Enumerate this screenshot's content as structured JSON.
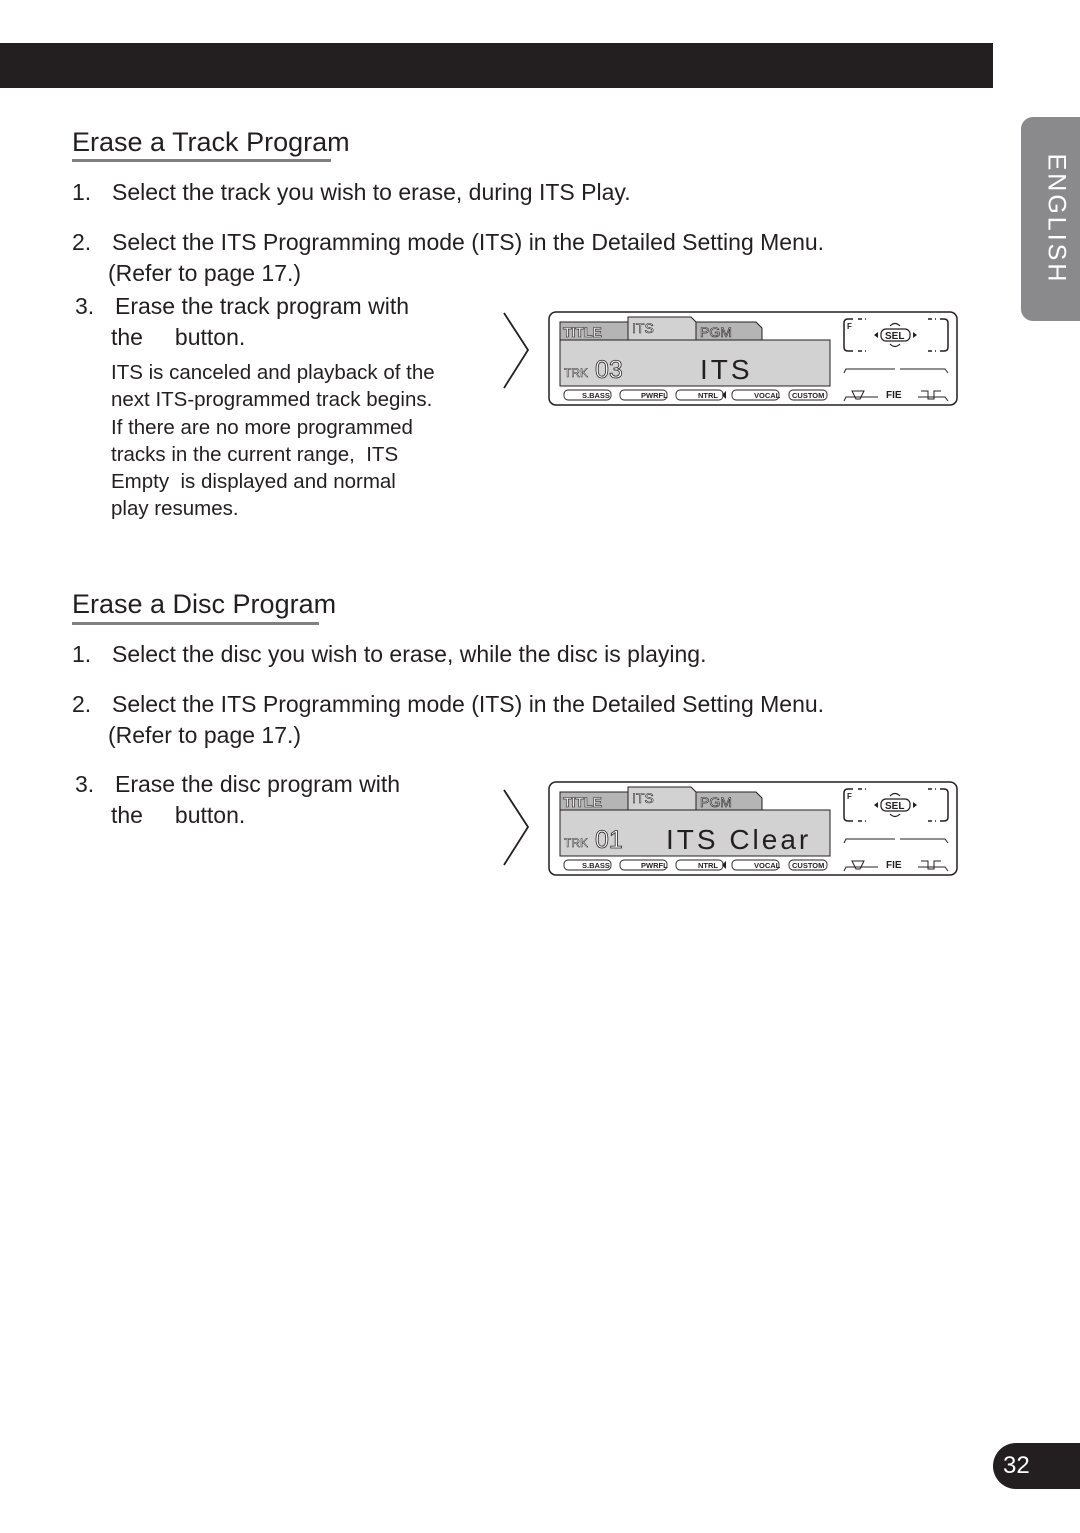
{
  "page": {
    "language_tab": "ENGLISH",
    "page_number": "32"
  },
  "section1": {
    "title": "Erase a Track Program",
    "steps": [
      {
        "num": "1.",
        "text": "Select the track you wish to erase, during ITS Play."
      },
      {
        "num": "2.",
        "text": "Select the ITS Programming mode (ITS) in the Detailed Setting Menu.",
        "text2": "(Refer to page 17.)"
      },
      {
        "num": "3.",
        "text": "Erase the track program with",
        "text2": "the     button."
      }
    ],
    "note_lines": [
      "ITS is canceled and playback of the",
      "next ITS-programmed track begins.",
      "If there are no more programmed",
      "tracks in the current range,  ITS",
      "Empty  is displayed and normal",
      "play resumes."
    ],
    "display": {
      "tabs": [
        "TITLE",
        "ITS",
        "PGM"
      ],
      "trk_label": "TRK",
      "trk_number": "03",
      "message": "ITS",
      "sel_label": "SEL",
      "f_label": "F",
      "fie_label": "FIE",
      "eq_presets": [
        "S.BASS",
        "PWRFL",
        "NTRL",
        "VOCAL",
        "CUSTOM"
      ]
    }
  },
  "section2": {
    "title": "Erase a Disc Program",
    "steps": [
      {
        "num": "1.",
        "text": "Select the disc you wish to erase, while the disc is playing."
      },
      {
        "num": "2.",
        "text": "Select the ITS Programming mode (ITS) in the Detailed Setting Menu.",
        "text2": "(Refer to page 17.)"
      },
      {
        "num": "3.",
        "text": "Erase the disc program with",
        "text2": "the     button."
      }
    ],
    "display": {
      "tabs": [
        "TITLE",
        "ITS",
        "PGM"
      ],
      "trk_label": "TRK",
      "trk_number": "01",
      "message": "ITS Clear",
      "sel_label": "SEL",
      "f_label": "F",
      "fie_label": "FIE",
      "eq_presets": [
        "S.BASS",
        "PWRFL",
        "NTRL",
        "VOCAL",
        "CUSTOM"
      ]
    }
  }
}
